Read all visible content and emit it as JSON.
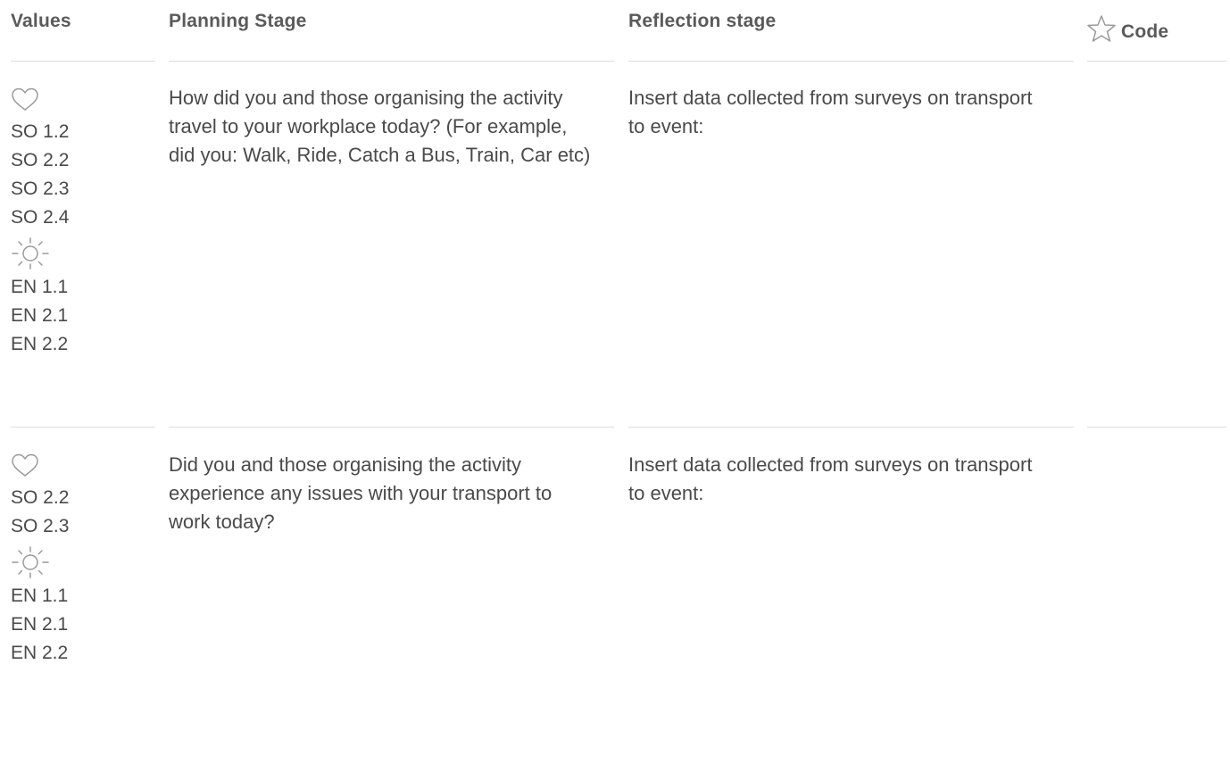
{
  "headers": {
    "values": "Values",
    "planning": "Planning Stage",
    "reflection": "Reflection stage",
    "code": "Code"
  },
  "icons": {
    "heart": "heart-icon",
    "sun": "sun-icon",
    "star": "star-icon"
  },
  "colors": {
    "text": "#4a4a4a",
    "header": "#5a5a5a",
    "rule": "#dedede",
    "icon": "#9a9a9a"
  },
  "rows": [
    {
      "social_codes": [
        "SO 1.2",
        "SO 2.2",
        "SO 2.3",
        "SO 2.4"
      ],
      "environment_codes": [
        "EN 1.1",
        "EN 2.1",
        "EN 2.2"
      ],
      "planning": "How did you and those organising the activity travel to your workplace today? (For example, did you: Walk, Ride, Catch a Bus, Train, Car etc)",
      "reflection": "Insert data collected from surveys on transport to event:"
    },
    {
      "social_codes": [
        "SO 2.2",
        "SO 2.3"
      ],
      "environment_codes": [
        "EN 1.1",
        "EN 2.1",
        "EN 2.2"
      ],
      "planning": "Did you and those organising the activity experience any issues with your transport to work today?",
      "reflection": "Insert data collected from surveys on transport to event:"
    }
  ]
}
